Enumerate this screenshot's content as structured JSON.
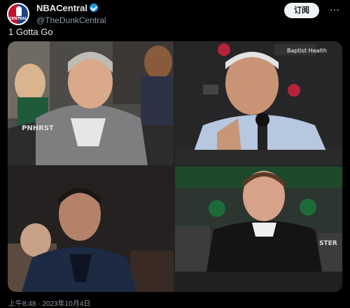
{
  "account": {
    "display_name": "NBACentral",
    "handle": "@TheDunkCentral",
    "avatar_text": "CENTRAL"
  },
  "follow_label": "订阅",
  "more_label": "···",
  "tweet_text": "1 Gotta Go",
  "images": {
    "top_left_jersey": "PNHRST",
    "top_right_sponsor": "Baptist Health",
    "bottom_right_banner": "STER"
  },
  "timestamp": "上午8:48 · 2023年10月4日",
  "colors": {
    "verified": "#1d9bf0",
    "background": "#000000"
  }
}
